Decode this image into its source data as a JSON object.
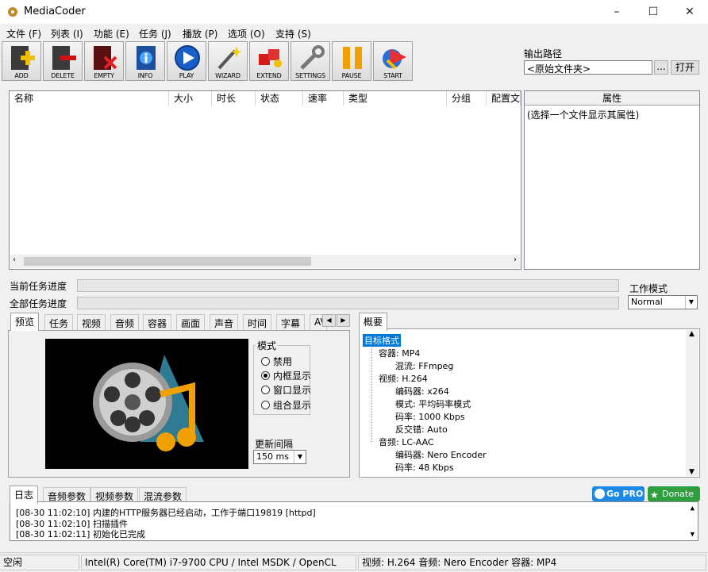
{
  "window": {
    "title": "MediaCoder",
    "minimize": "–",
    "maximize": "☐",
    "close": "✕"
  },
  "menu": [
    "文件 (F)",
    "列表 (I)",
    "功能 (E)",
    "任务 (J)",
    "播放 (P)",
    "选项 (O)",
    "支持 (S)"
  ],
  "toolbar": [
    {
      "label": "ADD",
      "icon": "add-icon"
    },
    {
      "label": "DELETE",
      "icon": "delete-icon"
    },
    {
      "label": "EMPTY",
      "icon": "empty-icon"
    },
    {
      "label": "INFO",
      "icon": "info-icon"
    },
    {
      "label": "PLAY",
      "icon": "play-icon"
    },
    {
      "label": "WIZARD",
      "icon": "wizard-icon"
    },
    {
      "label": "EXTEND",
      "icon": "extend-icon"
    },
    {
      "label": "SETTINGS",
      "icon": "settings-icon"
    },
    {
      "label": "PAUSE",
      "icon": "pause-icon"
    },
    {
      "label": "START",
      "icon": "start-icon"
    }
  ],
  "output": {
    "label": "输出路径",
    "value": "<原始文件夹>",
    "browse": "...",
    "open": "打开"
  },
  "filelist": {
    "columns": [
      "名称",
      "大小",
      "时长",
      "状态",
      "速率",
      "类型",
      "分组",
      "配置文"
    ]
  },
  "properties": {
    "header": "属性",
    "hint": "(选择一个文件显示其属性)"
  },
  "progress": {
    "current_label": "当前任务进度",
    "total_label": "全部任务进度",
    "current": 0,
    "total": 0
  },
  "workmode": {
    "label": "工作模式",
    "value": "Normal"
  },
  "tabs": [
    "预览",
    "任务",
    "视频",
    "音频",
    "容器",
    "画面",
    "声音",
    "时间",
    "字幕",
    "AV"
  ],
  "preview": {
    "mode_label": "模式",
    "modes": [
      "禁用",
      "内框显示",
      "窗口显示",
      "组合显示"
    ],
    "selected_mode": "内框显示",
    "interval_label": "更新间隔",
    "interval_value": "150 ms"
  },
  "summary": {
    "tab": "概要",
    "tree": [
      {
        "text": "目标格式",
        "level": 0,
        "selected": true
      },
      {
        "text": "容器: MP4",
        "level": 1
      },
      {
        "text": "混流: FFmpeg",
        "level": 2
      },
      {
        "text": "视频: H.264",
        "level": 1
      },
      {
        "text": "编码器: x264",
        "level": 2
      },
      {
        "text": "模式: 平均码率模式",
        "level": 2
      },
      {
        "text": "码率: 1000 Kbps",
        "level": 2
      },
      {
        "text": "反交错: Auto",
        "level": 2
      },
      {
        "text": "音频: LC-AAC",
        "level": 1
      },
      {
        "text": "编码器: Nero Encoder",
        "level": 2
      },
      {
        "text": "码率: 48 Kbps",
        "level": 2
      }
    ]
  },
  "logtabs": [
    "日志",
    "音频参数",
    "视频参数",
    "混流参数"
  ],
  "badges": {
    "gopro": "Go PRO",
    "donate": "Donate"
  },
  "log": [
    "[08-30 11:02:10] 内建的HTTP服务器已经启动，工作于端口19819 [httpd]",
    "[08-30 11:02:10] 扫描插件",
    "[08-30 11:02:11] 初始化已完成"
  ],
  "status": {
    "state": "空闲",
    "cpu": "Intel(R) Core(TM) i7-9700 CPU  / Intel MSDK / OpenCL",
    "format": "视频: H.264  音频: Nero Encoder  容器: MP4"
  },
  "colors": {
    "accent": "#0078d7",
    "selection": "#0078d7",
    "gopro": "#1e88e5",
    "donate": "#2e9e3e"
  }
}
